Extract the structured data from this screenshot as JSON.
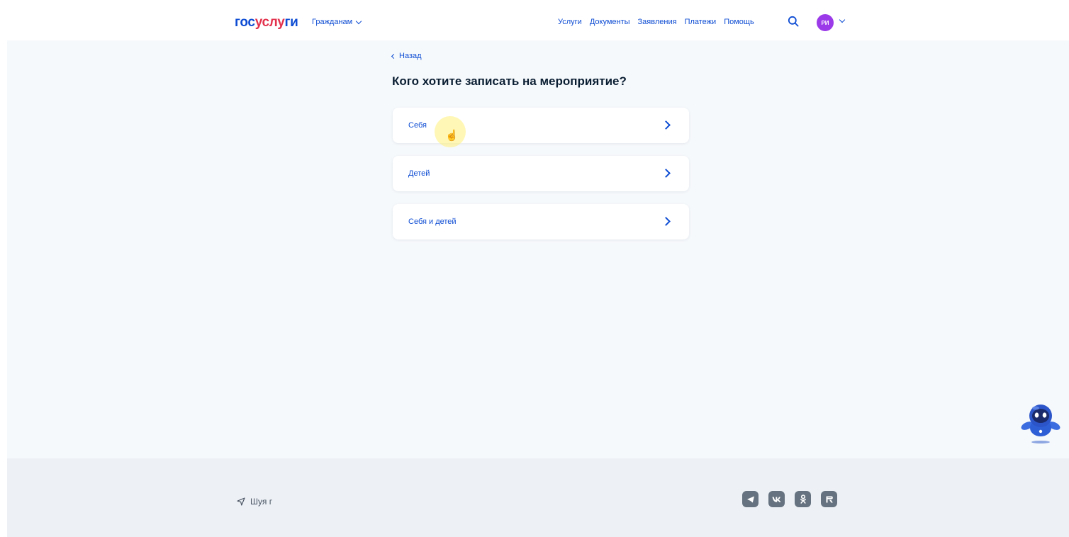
{
  "header": {
    "logo_part1": "гос",
    "logo_part2": "услу",
    "logo_part3": "ги",
    "audience_menu": "Гражданам",
    "nav": [
      "Услуги",
      "Документы",
      "Заявления",
      "Платежи",
      "Помощь"
    ],
    "avatar_initials": "РИ"
  },
  "main": {
    "back_label": "Назад",
    "title": "Кого хотите записать на мероприятие?",
    "options": [
      "Себя",
      "Детей",
      "Себя и детей"
    ]
  },
  "footer": {
    "location": "Шуя г",
    "socials": [
      "telegram-icon",
      "vk-icon",
      "odnoklassniki-icon",
      "rutube-icon"
    ]
  },
  "colors": {
    "accent": "#0d4cd3",
    "logo_red": "#e3324d",
    "avatar_bg": "#9b3ae8",
    "page_bg": "#f6f9fc",
    "footer_bg": "#edf1f6",
    "title_text": "#0b1f33"
  }
}
